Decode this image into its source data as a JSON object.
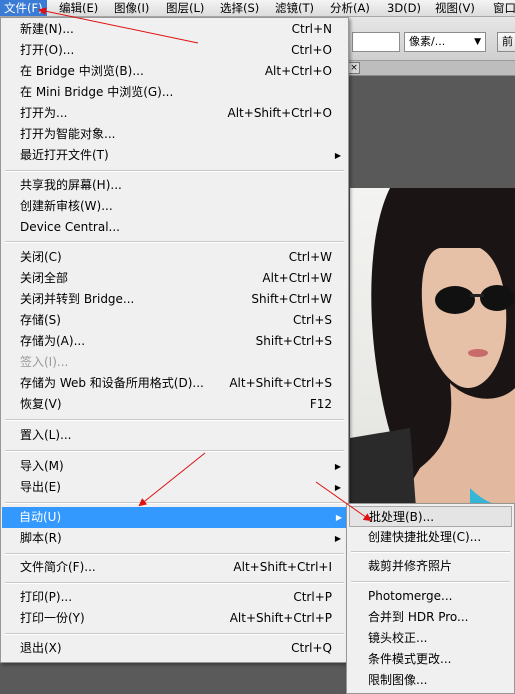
{
  "menubar": {
    "items": [
      "文件(F)",
      "编辑(E)",
      "图像(I)",
      "图层(L)",
      "选择(S)",
      "滤镜(T)",
      "分析(A)",
      "3D(D)",
      "视图(V)",
      "窗口"
    ]
  },
  "options_bar": {
    "unit_dropdown": "像素/...",
    "front_button": "前"
  },
  "file_menu": {
    "items": [
      {
        "label": "新建(N)...",
        "shortcut": "Ctrl+N"
      },
      {
        "label": "打开(O)...",
        "shortcut": "Ctrl+O"
      },
      {
        "label": "在 Bridge 中浏览(B)...",
        "shortcut": "Alt+Ctrl+O"
      },
      {
        "label": "在 Mini Bridge 中浏览(G)...",
        "shortcut": ""
      },
      {
        "label": "打开为...",
        "shortcut": "Alt+Shift+Ctrl+O"
      },
      {
        "label": "打开为智能对象...",
        "shortcut": ""
      },
      {
        "label": "最近打开文件(T)",
        "shortcut": "",
        "submenu": true
      },
      {
        "label": "共享我的屏幕(H)...",
        "shortcut": ""
      },
      {
        "label": "创建新审核(W)...",
        "shortcut": ""
      },
      {
        "label": "Device Central...",
        "shortcut": ""
      },
      {
        "label": "关闭(C)",
        "shortcut": "Ctrl+W"
      },
      {
        "label": "关闭全部",
        "shortcut": "Alt+Ctrl+W"
      },
      {
        "label": "关闭并转到 Bridge...",
        "shortcut": "Shift+Ctrl+W"
      },
      {
        "label": "存储(S)",
        "shortcut": "Ctrl+S"
      },
      {
        "label": "存储为(A)...",
        "shortcut": "Shift+Ctrl+S"
      },
      {
        "label": "签入(I)...",
        "shortcut": "",
        "disabled": true
      },
      {
        "label": "存储为 Web 和设备所用格式(D)...",
        "shortcut": "Alt+Shift+Ctrl+S"
      },
      {
        "label": "恢复(V)",
        "shortcut": "F12"
      },
      {
        "label": "置入(L)...",
        "shortcut": ""
      },
      {
        "label": "导入(M)",
        "shortcut": "",
        "submenu": true
      },
      {
        "label": "导出(E)",
        "shortcut": "",
        "submenu": true
      },
      {
        "label": "自动(U)",
        "shortcut": "",
        "submenu": true,
        "highlighted": true
      },
      {
        "label": "脚本(R)",
        "shortcut": "",
        "submenu": true
      },
      {
        "label": "文件简介(F)...",
        "shortcut": "Alt+Shift+Ctrl+I"
      },
      {
        "label": "打印(P)...",
        "shortcut": "Ctrl+P"
      },
      {
        "label": "打印一份(Y)",
        "shortcut": "Alt+Shift+Ctrl+P"
      },
      {
        "label": "退出(X)",
        "shortcut": "Ctrl+Q"
      }
    ]
  },
  "automate_submenu": {
    "items": [
      {
        "label": "批处理(B)...",
        "active": true
      },
      {
        "label": "创建快捷批处理(C)..."
      },
      {
        "label": "裁剪并修齐照片"
      },
      {
        "label": "Photomerge..."
      },
      {
        "label": "合并到 HDR Pro..."
      },
      {
        "label": "镜头校正..."
      },
      {
        "label": "条件模式更改..."
      },
      {
        "label": "限制图像..."
      }
    ]
  },
  "colors": {
    "highlight": "#3399ff",
    "menubar_active": "#3a7bd5",
    "annotation_arrow": "#e01010"
  },
  "icons": [
    "submenu-arrow-icon",
    "close-tab-icon",
    "dropdown-arrow-icon"
  ]
}
